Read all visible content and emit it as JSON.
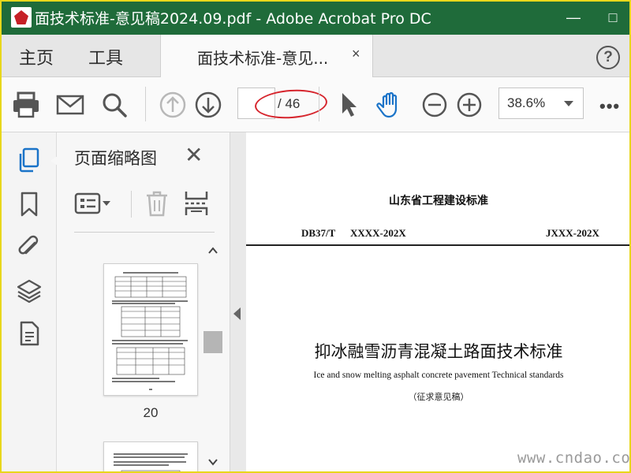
{
  "window": {
    "title": "面技术标准-意见稿2024.09.pdf - Adobe Acrobat Pro DC",
    "minimize": "—",
    "maximize": "□"
  },
  "tabs": {
    "home": "主页",
    "tools": "工具",
    "document": "面技术标准-意见...",
    "close": "×",
    "help": "?"
  },
  "toolbar": {
    "page_current": "",
    "page_total": "/ 46",
    "zoom": "38.6%",
    "more": "•••"
  },
  "panel": {
    "title": "页面缩略图",
    "thumbnails": [
      {
        "label": "20",
        "selected": false
      },
      {
        "label": "",
        "selected": false
      }
    ]
  },
  "document": {
    "org": "山东省工程建设标准",
    "std_prefix": "DB37/T",
    "std_code": "XXXX-202X",
    "std_right": "JXXX-202X",
    "title_cn": "抑冰融雪沥青混凝土路面技术标准",
    "title_en": "Ice and snow melting asphalt concrete pavement Technical standards",
    "draft": "（征求意见稿）"
  },
  "watermark": "www.cndao.com",
  "colors": {
    "titlebar": "#1f6b3a",
    "accent_blue": "#1a73c8",
    "annotation_red": "#d6252d"
  }
}
